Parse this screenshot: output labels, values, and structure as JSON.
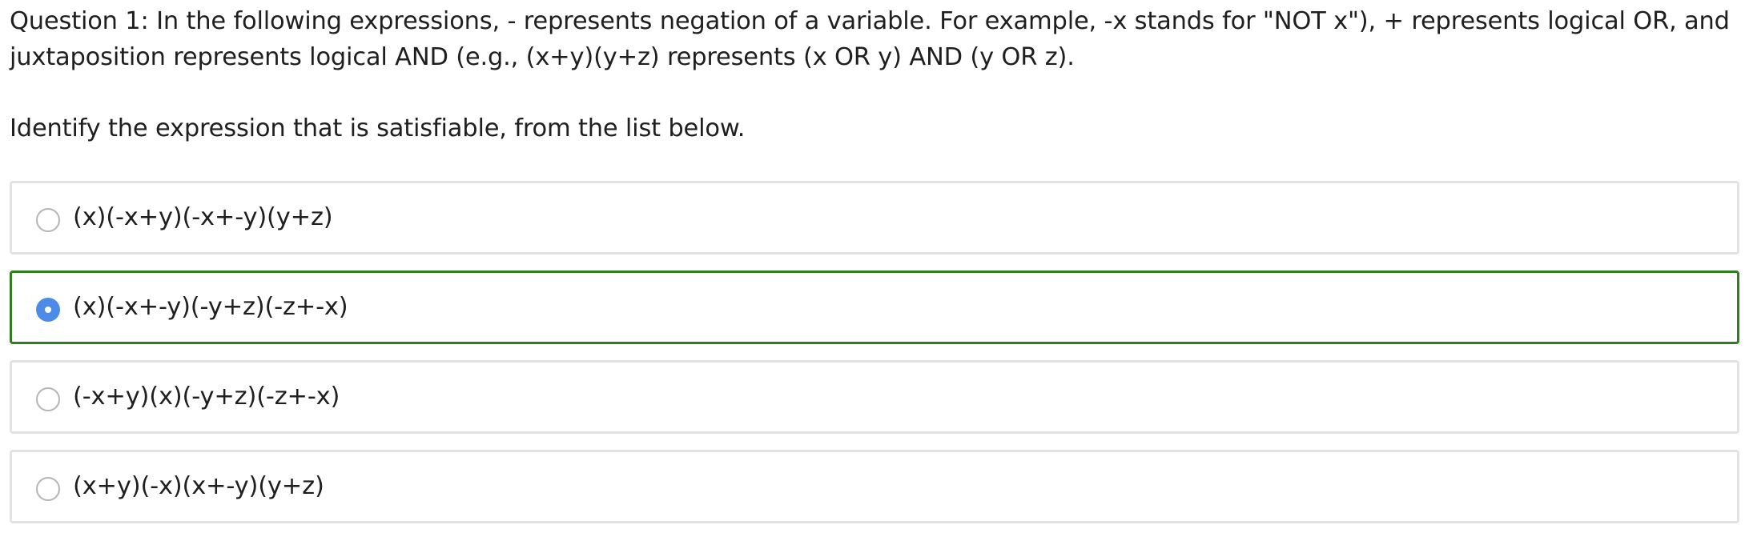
{
  "question": {
    "line1": "Question 1: In the following expressions, - represents negation of a variable. For example, -x stands for \"NOT x\"), + represents logical OR, and",
    "line2": "juxtaposition represents logical AND (e.g., (x+y)(y+z) represents (x OR y) AND (y OR z).",
    "instruction": "Identify the expression that is satisfiable, from the list below."
  },
  "options": [
    {
      "label": "(x)(-x+y)(-x+-y)(y+z)",
      "selected": false
    },
    {
      "label": "(x)(-x+-y)(-y+z)(-z+-x)",
      "selected": true
    },
    {
      "label": "(-x+y)(x)(-y+z)(-z+-x)",
      "selected": false
    },
    {
      "label": "(x+y)(-x)(x+-y)(y+z)",
      "selected": false
    }
  ],
  "colors": {
    "selected_border": "#2e7d1e",
    "selected_radio": "#4d8ce6",
    "option_border": "#e2e2e2"
  }
}
